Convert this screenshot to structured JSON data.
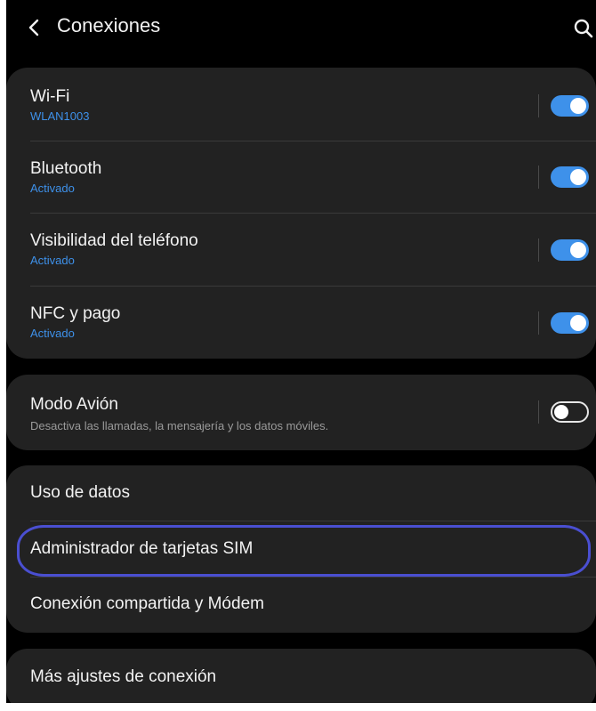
{
  "header": {
    "title": "Conexiones",
    "back_icon": "chevron-left-icon",
    "search_icon": "search-icon"
  },
  "group1": [
    {
      "label": "Wi-Fi",
      "subtitle": "WLAN1003",
      "toggle": true
    },
    {
      "label": "Bluetooth",
      "subtitle": "Activado",
      "toggle": true
    },
    {
      "label": "Visibilidad del teléfono",
      "subtitle": "Activado",
      "toggle": true
    },
    {
      "label": "NFC y pago",
      "subtitle": "Activado",
      "toggle": true
    }
  ],
  "group2": [
    {
      "label": "Modo Avión",
      "subtitle": "Desactiva las llamadas, la mensajería y los datos móviles.",
      "toggle": false
    }
  ],
  "group3": [
    {
      "label": "Uso de datos"
    },
    {
      "label": "Administrador de tarjetas SIM",
      "highlighted": true
    },
    {
      "label": "Conexión compartida y Módem"
    }
  ],
  "group4": [
    {
      "label": "Más ajustes de conexión"
    }
  ],
  "colors": {
    "accent": "#3e91ea",
    "highlight": "#4a4fd1",
    "card": "#222222",
    "background": "#000000"
  }
}
